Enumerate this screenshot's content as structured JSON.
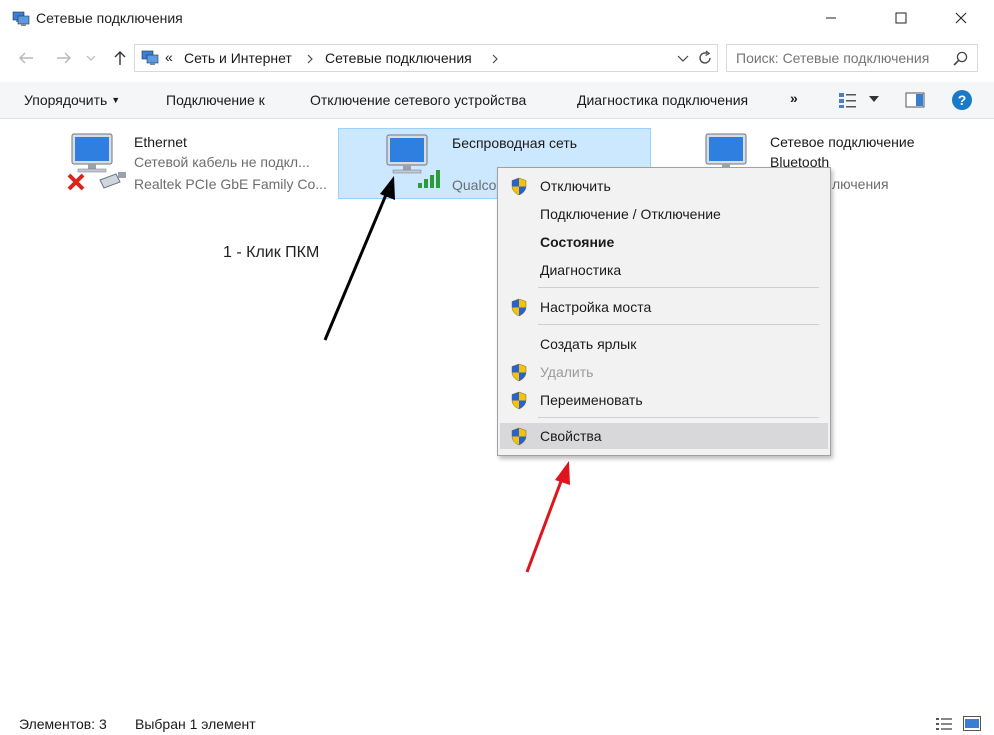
{
  "window": {
    "title": "Сетевые подключения",
    "buttons": {
      "minimize": "minimize",
      "maximize": "maximize",
      "close": "close"
    }
  },
  "address": {
    "overflow": "«",
    "segments": [
      "Сеть и Интернет",
      "Сетевые подключения"
    ],
    "search_placeholder": "Поиск: Сетевые подключения"
  },
  "toolbar": {
    "organize": "Упорядочить",
    "connect": "Подключение к",
    "disable": "Отключение сетевого устройства",
    "diagnose": "Диагностика подключения",
    "more": "»"
  },
  "items": [
    {
      "name": "Ethernet",
      "line1": "Сетевой кабель не подкл...",
      "line2": "Realtek PCIe GbE Family Co...",
      "status_icon": "red-x-icon"
    },
    {
      "name": "Беспроводная сеть",
      "line1": "",
      "line2": "Qualco",
      "status_icon": "wifi-bars-icon",
      "selected": true
    },
    {
      "name": "Сетевое подключение",
      "name2": "Bluetooth",
      "line1": "лючения"
    }
  ],
  "annotation": {
    "text": "1 - Клик ПКМ"
  },
  "context_menu": {
    "items": [
      {
        "label": "Отключить",
        "shield": true,
        "bold": false,
        "disabled": false
      },
      {
        "label": "Подключение / Отключение",
        "shield": false,
        "bold": false,
        "disabled": false
      },
      {
        "label": "Состояние",
        "shield": false,
        "bold": true,
        "disabled": false
      },
      {
        "label": "Диагностика",
        "shield": false,
        "bold": false,
        "disabled": false
      },
      {
        "label": "Настройка моста",
        "shield": true,
        "bold": false,
        "disabled": false
      },
      {
        "label": "Создать ярлык",
        "shield": false,
        "bold": false,
        "disabled": false
      },
      {
        "label": "Удалить",
        "shield": true,
        "bold": false,
        "disabled": true
      },
      {
        "label": "Переименовать",
        "shield": true,
        "bold": false,
        "disabled": false
      },
      {
        "label": "Свойства",
        "shield": true,
        "bold": false,
        "disabled": false,
        "highlighted": true
      }
    ]
  },
  "status_bar": {
    "count": "Элементов: 3",
    "selected": "Выбран 1 элемент"
  },
  "colors": {
    "selection_bg": "#cce8ff",
    "selection_border": "#99d1ff",
    "help_blue": "#1979ca",
    "arrow_black": "#000000",
    "arrow_red": "#e0141e"
  }
}
